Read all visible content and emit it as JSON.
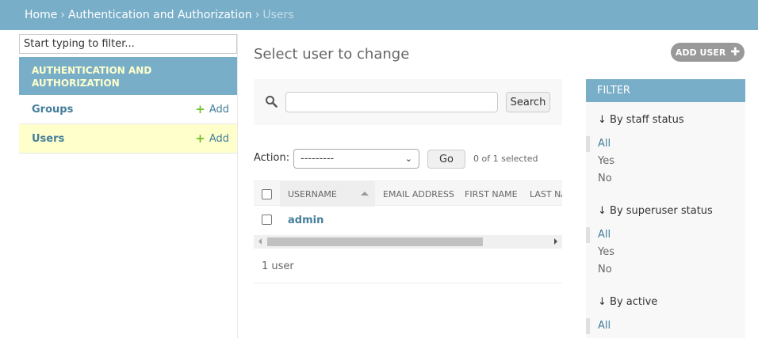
{
  "breadcrumb": {
    "home": "Home",
    "app": "Authentication and Authorization",
    "current": "Users",
    "separator": "›"
  },
  "sidebar": {
    "filter_placeholder": "Start typing to filter...",
    "app_caption": "Authentication and Authorization",
    "models": [
      {
        "label": "Groups",
        "add_label": "Add",
        "active": false
      },
      {
        "label": "Users",
        "add_label": "Add",
        "active": true
      }
    ]
  },
  "main": {
    "title": "Select user to change",
    "add_button": "Add user",
    "search_button": "Search",
    "action_label": "Action:",
    "action_selected": "---------",
    "go_button": "Go",
    "selected_counter": "0 of 1 selected",
    "columns": [
      "Username",
      "Email address",
      "First name",
      "Last na"
    ],
    "rows": [
      {
        "username": "admin"
      }
    ],
    "paginator": "1 user"
  },
  "filter": {
    "title": "Filter",
    "groups": [
      {
        "heading": "↓ By staff status",
        "options": [
          "All",
          "Yes",
          "No"
        ]
      },
      {
        "heading": "↓ By superuser status",
        "options": [
          "All",
          "Yes",
          "No"
        ]
      },
      {
        "heading": "↓ By active",
        "options": [
          "All"
        ]
      }
    ]
  },
  "colors": {
    "header": "#79aec8",
    "link": "#447e9b",
    "caption_text": "#ffffcc",
    "add_icon": "#70bf2b"
  }
}
